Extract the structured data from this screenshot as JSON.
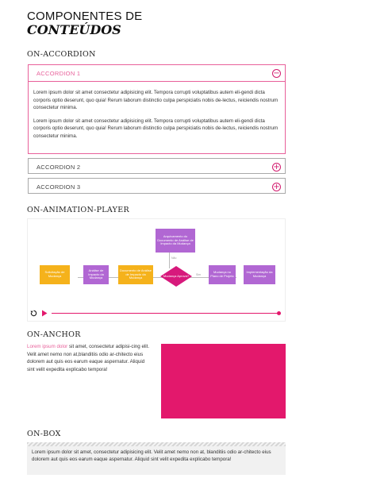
{
  "page": {
    "title_line1": "COMPONENTES DE",
    "title_line2": "CONTEÚDOS"
  },
  "accordion_section": {
    "heading": "ON-ACCORDION",
    "items": [
      {
        "label": "ACCORDION 1",
        "expanded": true,
        "toggle_icon": "minus-circle-icon",
        "paragraphs": [
          "Lorem ipsum dolor sit amet consectetur adipisicing elit. Tempora corrupti voluptatibus autem eli-gendi dicta corporis optio deserunt, quo quia! Rerum laborum distinctio culpa perspiciatis nobis de-lectus, reiciendis nostrum consectetur minima.",
          "Lorem ipsum dolor sit amet consectetur adipisicing elit. Tempora corrupti voluptatibus autem eli-gendi dicta corporis optio deserunt, quo quia! Rerum laborum distinctio culpa perspiciatis nobis de-lectus, reiciendis nostrum consectetur minima."
        ]
      },
      {
        "label": "ACCORDION 2",
        "expanded": false,
        "toggle_icon": "plus-circle-icon"
      },
      {
        "label": "ACCORDION 3",
        "expanded": false,
        "toggle_icon": "plus-circle-icon"
      }
    ]
  },
  "animation_section": {
    "heading": "ON-ANIMATION-PLAYER",
    "diagram": {
      "nodes": {
        "solicitacao": "Solicitação de Mudança",
        "analise": "Análise de Impacto da Mudança",
        "documento": "Documento de Análise de Impacto da Mudança",
        "decisao": "Mudança Aprova?",
        "arquivamento": "Arquivamento do Documento de Análise de Impacto da Mudança",
        "planejamento": "Mudança no Plano de Projeto",
        "implementacao": "Implementação da Mudança"
      },
      "edge_labels": {
        "nao": "Não",
        "sim": "Sim"
      }
    },
    "controls": {
      "replay_icon": "replay-icon",
      "play_icon": "play-icon",
      "progress": 1.0
    }
  },
  "anchor_section": {
    "heading": "ON-ANCHOR",
    "highlight": "Lorem ipsum dolor",
    "text": " sit amet, consectetur adipisi-cing elit. Velit amet nemo non at,blanditiis odio ar-chitecto eius dolorem aut quis eos earum eaque aspernatur. Aliquid sint velit expedita explicabo tempora!"
  },
  "box_section": {
    "heading": "ON-BOX",
    "text": "Lorem ipsum dolor sit amet, consectetur adipisicing elit. Velit amet nemo non at, blanditiis odio ar-chitecto eius dolorem aut quis eos earum eaque aspernatur. Aliquid sint velit expedita explicabo tempora!"
  },
  "colors": {
    "accent": "#e3186c",
    "accent_light": "#e8609a",
    "flow_purple": "#b167d3",
    "flow_yellow": "#f5b21b"
  }
}
